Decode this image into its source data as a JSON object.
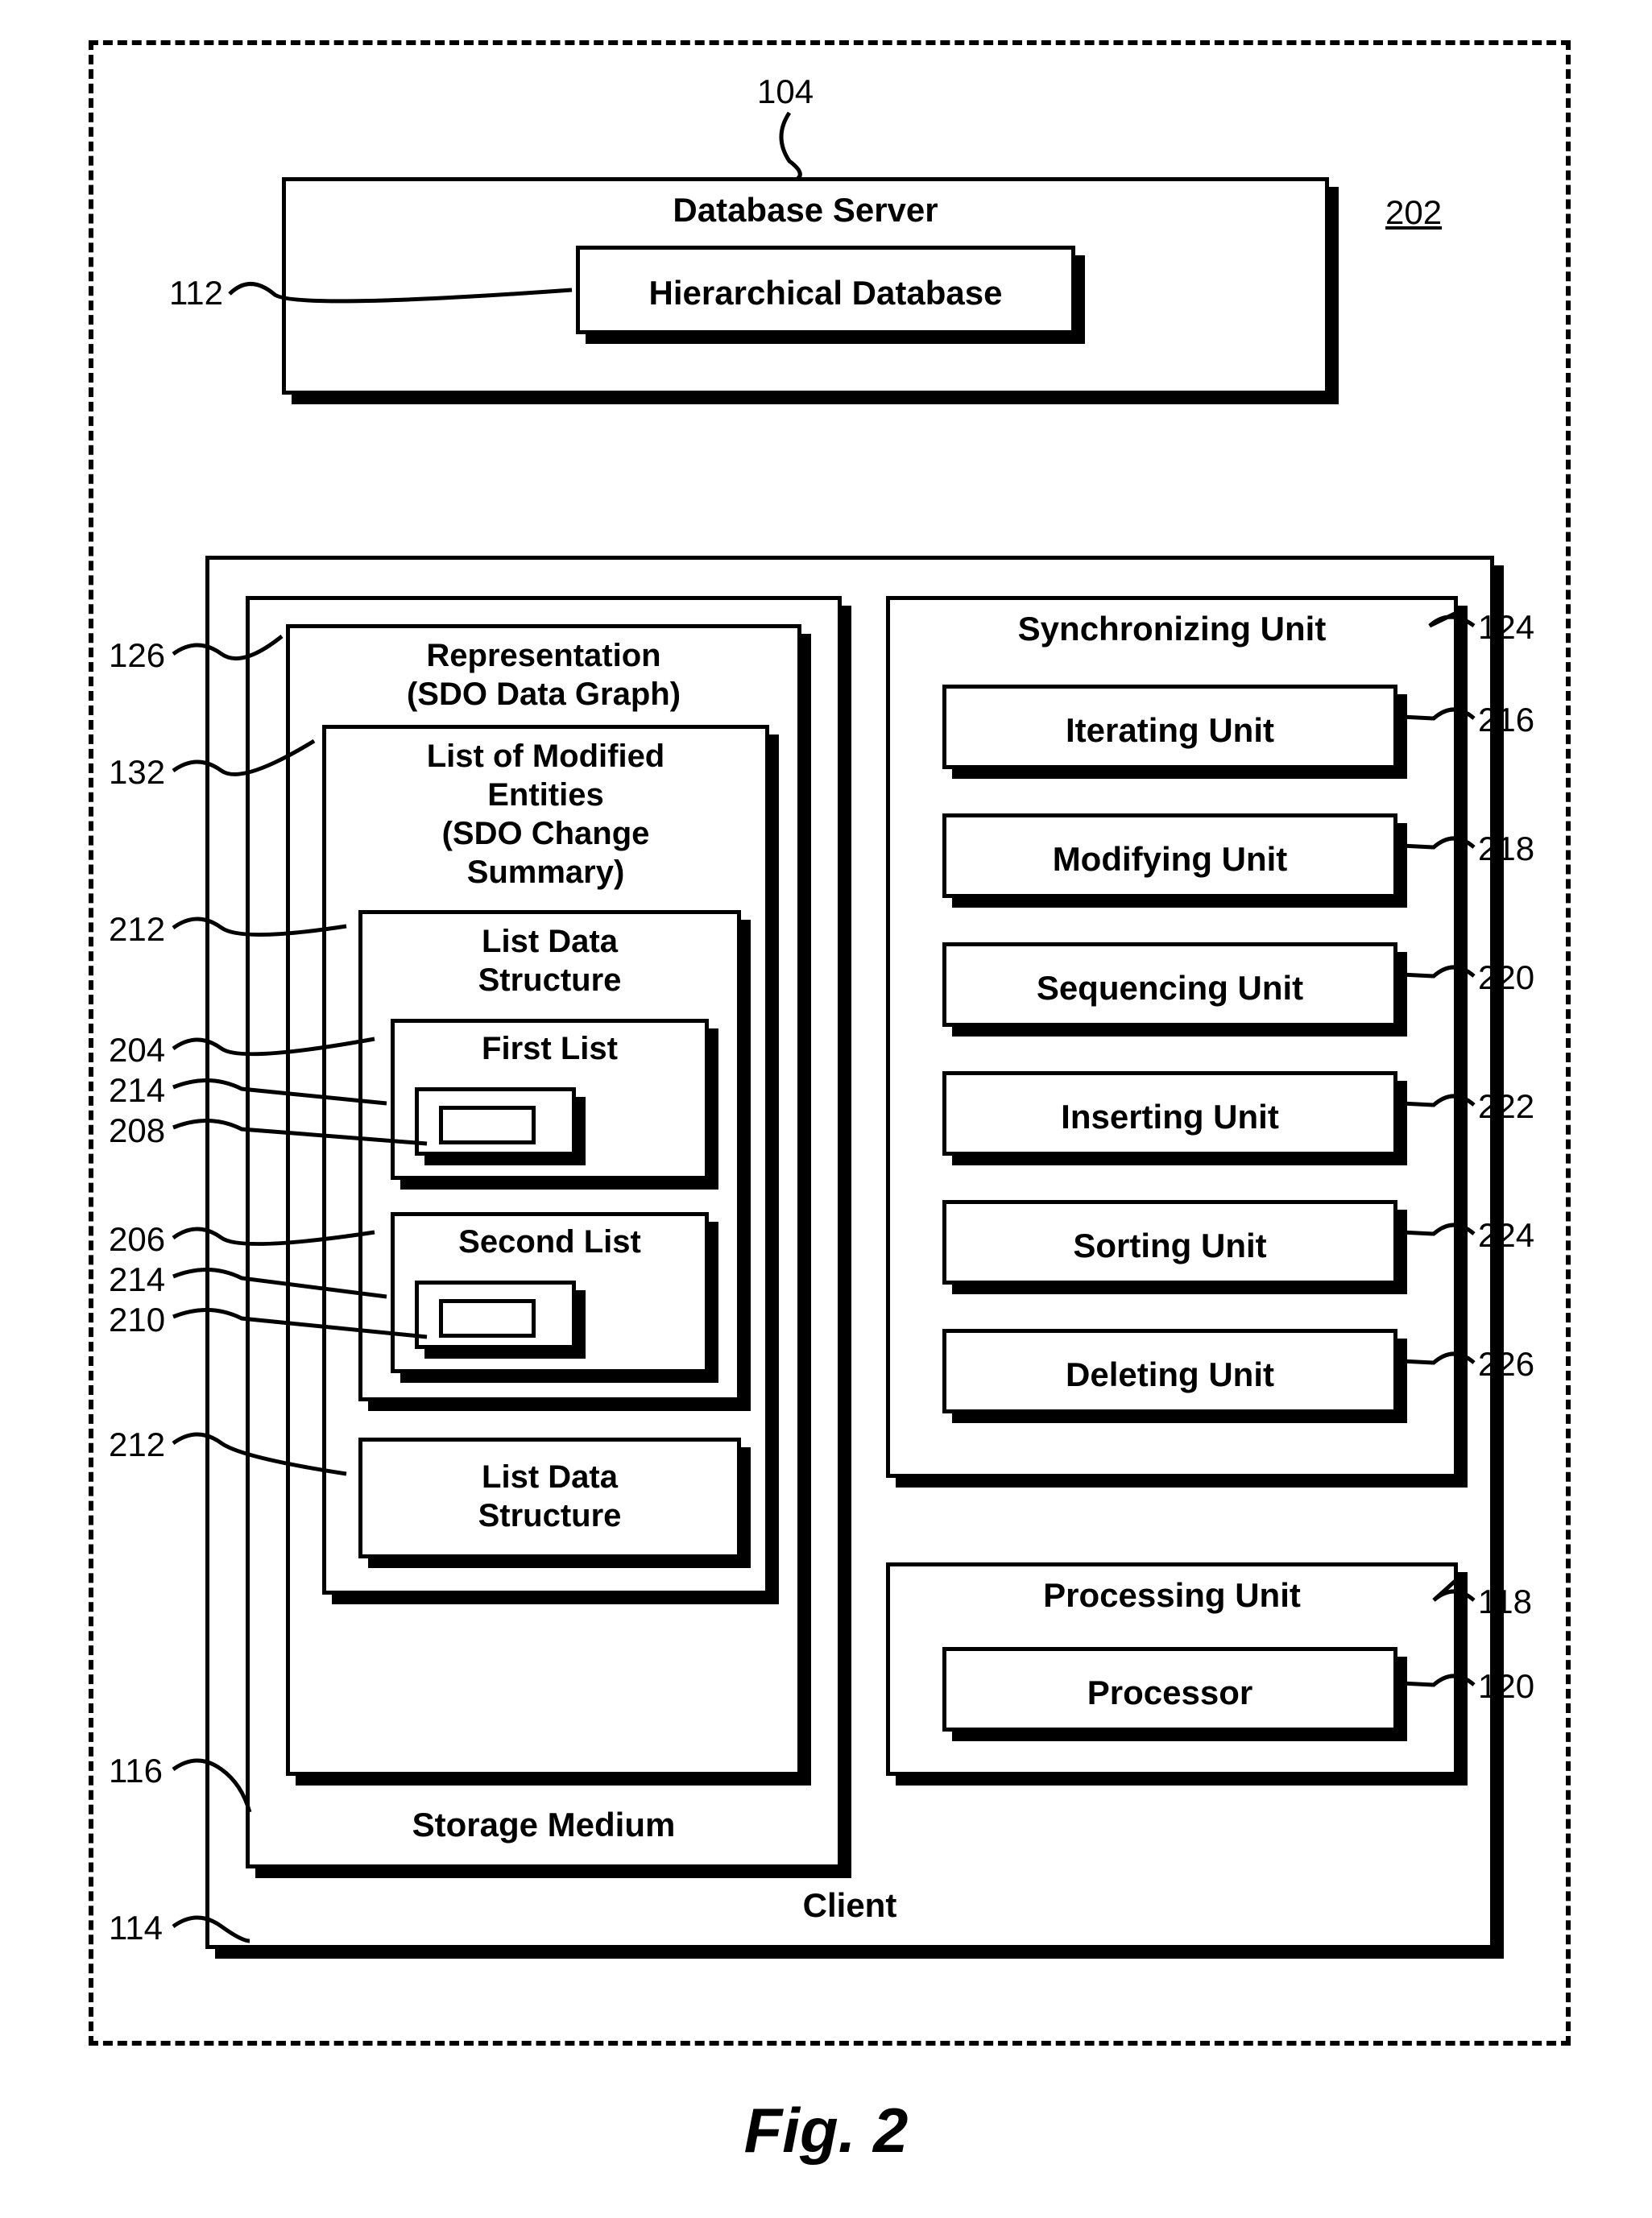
{
  "refs": {
    "r104": "104",
    "r202": "202",
    "r112": "112",
    "r114": "114",
    "r116": "116",
    "r126": "126",
    "r132": "132",
    "r212a": "212",
    "r204": "204",
    "r214a": "214",
    "r208": "208",
    "r206": "206",
    "r214b": "214",
    "r210": "210",
    "r212b": "212",
    "r124": "124",
    "r216": "216",
    "r218": "218",
    "r220": "220",
    "r222": "222",
    "r224": "224",
    "r226": "226",
    "r118": "118",
    "r120": "120"
  },
  "labels": {
    "database_server": "Database Server",
    "hierarchical_db": "Hierarchical Database",
    "client": "Client",
    "storage_medium": "Storage Medium",
    "representation": "Representation\n(SDO Data Graph)",
    "list_modified": "List of Modified\nEntities\n(SDO Change\nSummary)",
    "list_data_structure": "List Data\nStructure",
    "first_list": "First List",
    "second_list": "Second List",
    "sync_unit": "Synchronizing Unit",
    "iterating": "Iterating Unit",
    "modifying": "Modifying Unit",
    "sequencing": "Sequencing Unit",
    "inserting": "Inserting Unit",
    "sorting": "Sorting Unit",
    "deleting": "Deleting Unit",
    "processing_unit": "Processing Unit",
    "processor": "Processor"
  },
  "caption": "Fig. 2"
}
